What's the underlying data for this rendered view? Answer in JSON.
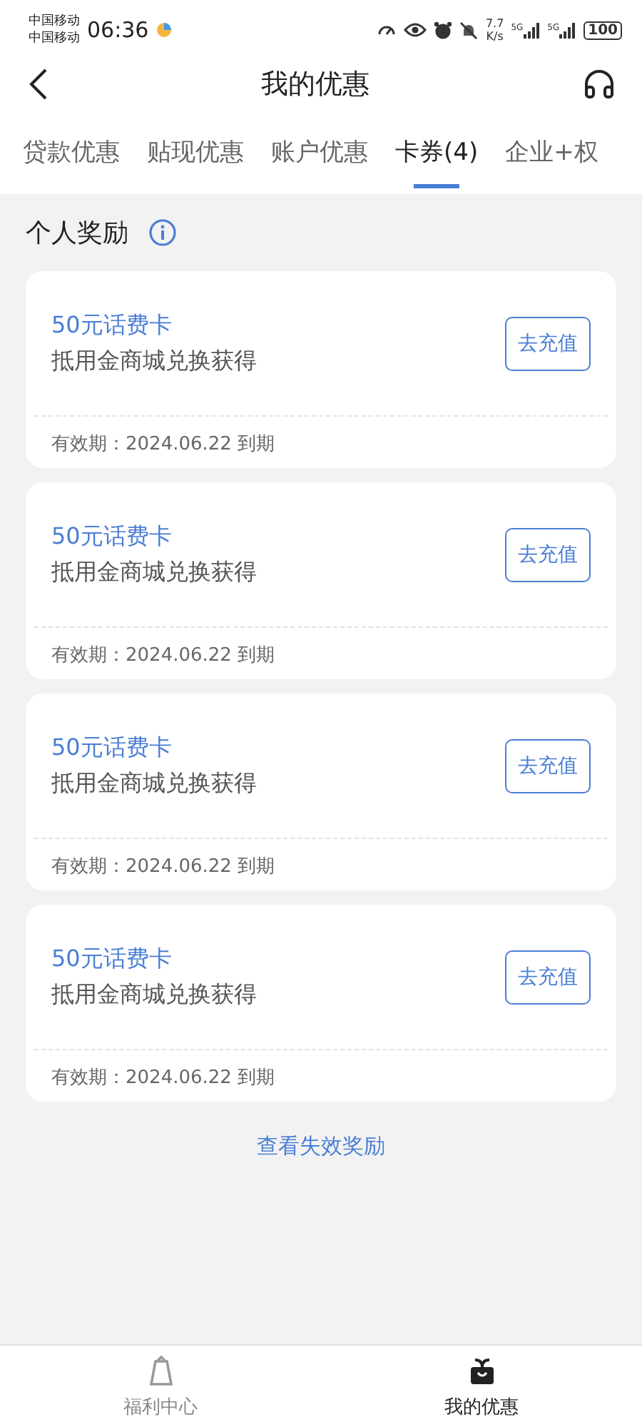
{
  "status_bar": {
    "carriers": [
      "中国移动",
      "中国移动"
    ],
    "time": "06:36",
    "speed": [
      "7.7",
      "K/s"
    ],
    "networks": [
      "5G",
      "5G"
    ],
    "battery": "100"
  },
  "header": {
    "title": "我的优惠"
  },
  "tabs": [
    {
      "label": "贷款优惠",
      "selected": false
    },
    {
      "label": "贴现优惠",
      "selected": false
    },
    {
      "label": "账户优惠",
      "selected": false
    },
    {
      "label": "卡券(4)",
      "selected": true
    },
    {
      "label": "企业+权",
      "selected": false
    }
  ],
  "section": {
    "title": "个人奖励"
  },
  "coupons": [
    {
      "name": "50元话费卡",
      "source": "抵用金商城兑换获得",
      "action": "去充值",
      "validity": "有效期：2024.06.22 到期"
    },
    {
      "name": "50元话费卡",
      "source": "抵用金商城兑换获得",
      "action": "去充值",
      "validity": "有效期：2024.06.22 到期"
    },
    {
      "name": "50元话费卡",
      "source": "抵用金商城兑换获得",
      "action": "去充值",
      "validity": "有效期：2024.06.22 到期"
    },
    {
      "name": "50元话费卡",
      "source": "抵用金商城兑换获得",
      "action": "去充值",
      "validity": "有效期：2024.06.22 到期"
    }
  ],
  "expired_link": "查看失效奖励",
  "bottom_nav": [
    {
      "label": "福利中心",
      "selected": false
    },
    {
      "label": "我的优惠",
      "selected": true
    }
  ]
}
